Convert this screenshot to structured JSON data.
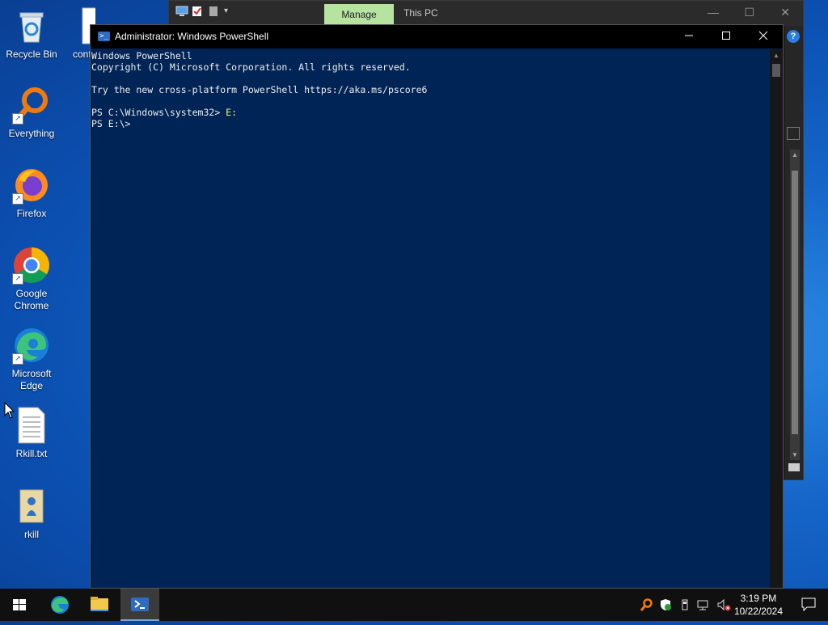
{
  "desktop": {
    "icons": [
      {
        "label": "Recycle Bin"
      },
      {
        "label": "conf"
      },
      {
        "label": "Everything"
      },
      {
        "label": "Firefox"
      },
      {
        "label": "Google Chrome"
      },
      {
        "label": "Microsoft Edge"
      },
      {
        "label": "Rkill.txt"
      },
      {
        "label": "rkill"
      }
    ]
  },
  "explorer": {
    "manage_tab": "Manage",
    "title": "This PC",
    "minimize": "—",
    "maximize": "☐",
    "close": "✕",
    "help": "?"
  },
  "powershell": {
    "title": "Administrator: Windows PowerShell",
    "lines": [
      "Windows PowerShell",
      "Copyright (C) Microsoft Corporation. All rights reserved.",
      "",
      "Try the new cross-platform PowerShell https://aka.ms/pscore6",
      ""
    ],
    "prompt1": "PS C:\\Windows\\system32> ",
    "cmd1": "E:",
    "prompt2": "PS E:\\>"
  },
  "taskbar": {
    "time": "3:19 PM",
    "date": "10/22/2024"
  },
  "colors": {
    "ps_background": "#012456",
    "manage_tab": "#b7e3a1",
    "taskbar": "#101010"
  }
}
